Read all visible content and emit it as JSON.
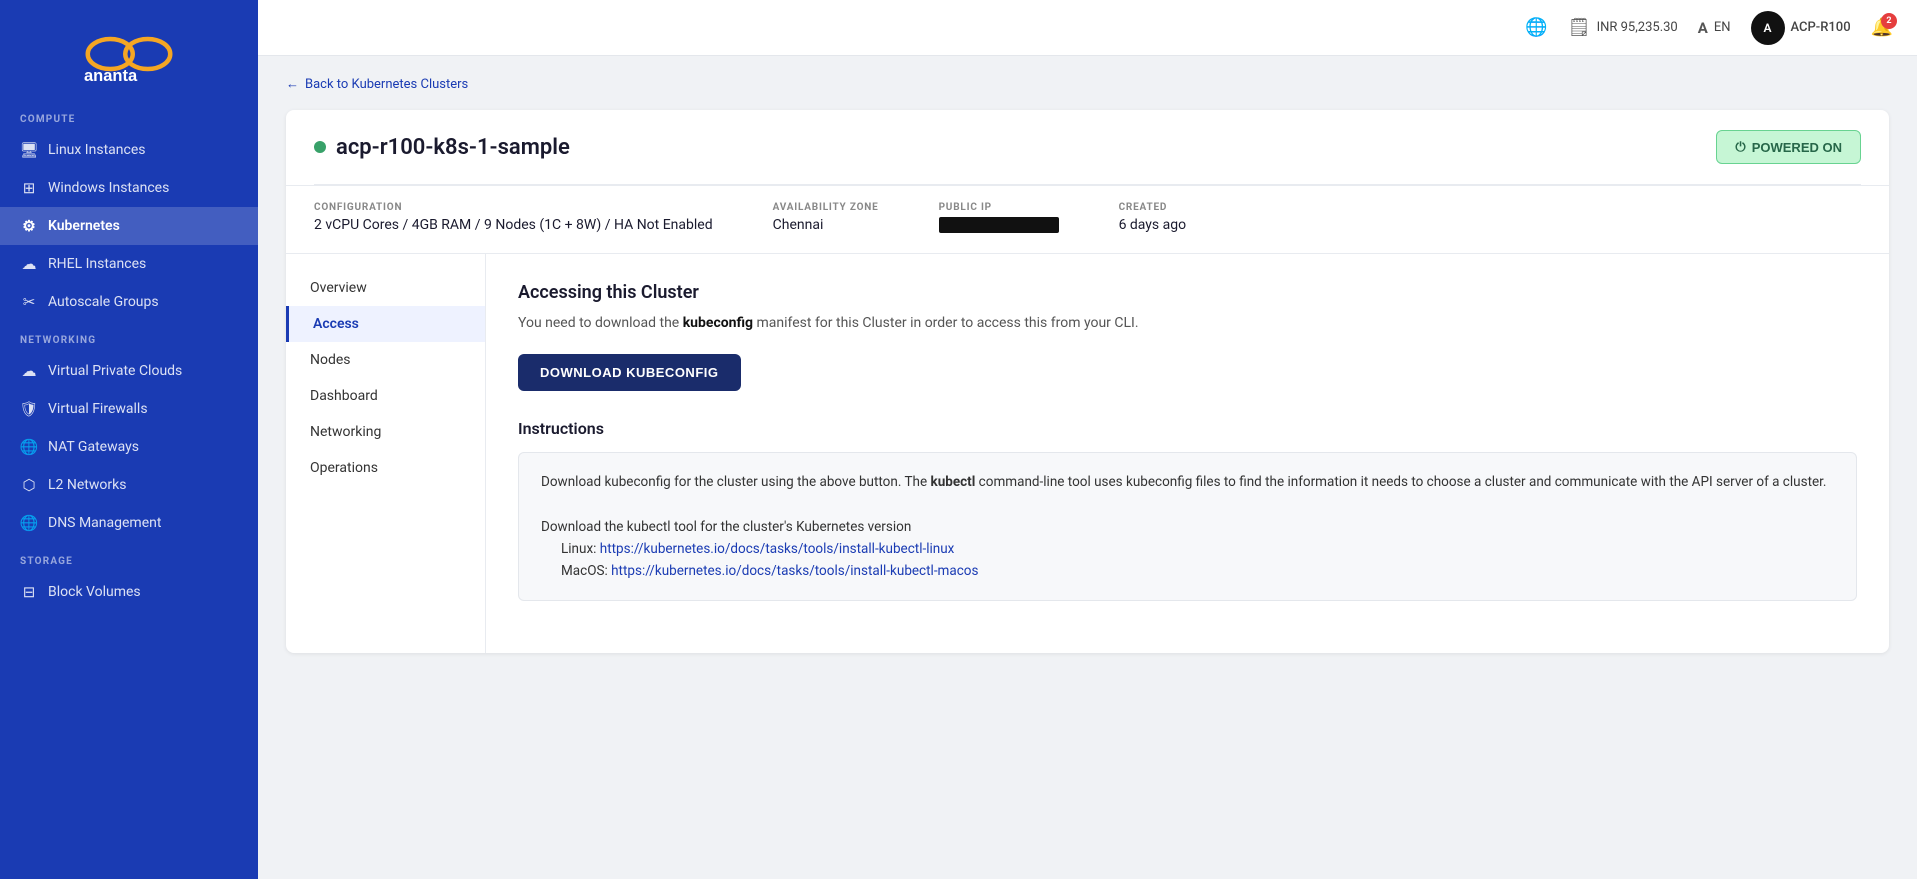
{
  "sidebar": {
    "logo_alt": "Ananta STPI Cloud Services",
    "sections": [
      {
        "label": "COMPUTE",
        "items": [
          {
            "id": "linux-instances",
            "label": "Linux Instances",
            "icon": "🖥",
            "active": false
          },
          {
            "id": "windows-instances",
            "label": "Windows Instances",
            "icon": "⊞",
            "active": false
          },
          {
            "id": "kubernetes",
            "label": "Kubernetes",
            "icon": "⚙",
            "active": true
          },
          {
            "id": "rhel-instances",
            "label": "RHEL Instances",
            "icon": "☁",
            "active": false
          },
          {
            "id": "autoscale-groups",
            "label": "Autoscale Groups",
            "icon": "✂",
            "active": false
          }
        ]
      },
      {
        "label": "NETWORKING",
        "items": [
          {
            "id": "virtual-private-clouds",
            "label": "Virtual Private Clouds",
            "icon": "☁",
            "active": false
          },
          {
            "id": "virtual-firewalls",
            "label": "Virtual Firewalls",
            "icon": "🛡",
            "active": false
          },
          {
            "id": "nat-gateways",
            "label": "NAT Gateways",
            "icon": "🌐",
            "active": false
          },
          {
            "id": "l2-networks",
            "label": "L2 Networks",
            "icon": "⬡",
            "active": false
          },
          {
            "id": "dns-management",
            "label": "DNS Management",
            "icon": "🌐",
            "active": false
          }
        ]
      },
      {
        "label": "STORAGE",
        "items": [
          {
            "id": "block-volumes",
            "label": "Block Volumes",
            "icon": "⊟",
            "active": false
          }
        ]
      }
    ]
  },
  "topbar": {
    "globe_icon": "🌐",
    "billing_icon": "💳",
    "billing_amount": "INR 95,235.30",
    "language_icon": "A",
    "language": "EN",
    "user_name": "ACP-R100",
    "notification_count": "2"
  },
  "breadcrumb": {
    "back_label": "Back to Kubernetes Clusters"
  },
  "cluster": {
    "name": "acp-r100-k8s-1-sample",
    "status": "powered_on",
    "status_label": "POWERED ON",
    "config_label": "CONFIGURATION",
    "config_value": "2 vCPU Cores / 4GB RAM / 9 Nodes (1C + 8W) / HA Not Enabled",
    "az_label": "AVAILABILITY ZONE",
    "az_value": "Chennai",
    "ip_label": "PUBLIC IP",
    "ip_redacted": true,
    "created_label": "CREATED",
    "created_value": "6 days ago"
  },
  "sidenav": {
    "items": [
      {
        "id": "overview",
        "label": "Overview",
        "active": false
      },
      {
        "id": "access",
        "label": "Access",
        "active": true
      },
      {
        "id": "nodes",
        "label": "Nodes",
        "active": false
      },
      {
        "id": "dashboard",
        "label": "Dashboard",
        "active": false
      },
      {
        "id": "networking",
        "label": "Networking",
        "active": false
      },
      {
        "id": "operations",
        "label": "Operations",
        "active": false
      }
    ]
  },
  "access_section": {
    "title": "Accessing this Cluster",
    "description_part1": "You need to download the ",
    "kubeconfig_bold": "kubeconfig",
    "description_part2": " manifest for this Cluster in order to access this from your CLI.",
    "download_button": "DOWNLOAD KUBECONFIG",
    "instructions_title": "Instructions",
    "instructions_line1_part1": "Download kubeconfig for the cluster using the above button. The ",
    "instructions_kubectl_bold": "kubectl",
    "instructions_line1_part2": " command-line tool uses kubeconfig files to find the information it needs to choose a cluster and communicate with the API server of a cluster.",
    "instructions_line2": "Download the kubectl tool for the cluster's Kubernetes version",
    "instructions_linux_label": "Linux: ",
    "instructions_linux_url": "https://kubernetes.io/docs/tasks/tools/install-kubectl-linux",
    "instructions_macos_label": "MacOS: ",
    "instructions_macos_url": "https://kubernetes.io/docs/tasks/tools/install-kubectl-macos"
  }
}
